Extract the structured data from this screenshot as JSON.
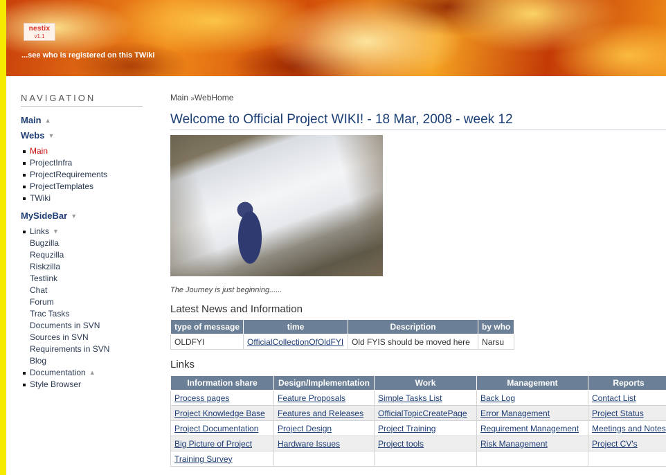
{
  "header": {
    "logo_text": "nestix",
    "logo_sub": "v1.1",
    "registered_link": "...see who is registered on this TWiki"
  },
  "sidebar": {
    "nav_title": "NAVIGATION",
    "main_label": "Main",
    "webs_label": "Webs",
    "webs": [
      "Main",
      "ProjectInfra",
      "ProjectRequirements",
      "ProjectTemplates",
      "TWiki"
    ],
    "mysidebar_label": "MySideBar",
    "links_label": "Links",
    "links": [
      "Bugzilla",
      "Requzilla",
      "Riskzilla",
      "Testlink",
      "Chat",
      "Forum",
      "Trac Tasks",
      "Documents in SVN",
      "Sources in SVN",
      "Requirements in SVN",
      "Blog"
    ],
    "documentation_label": "Documentation",
    "style_browser_label": "Style Browser"
  },
  "main": {
    "breadcrumb_main": "Main",
    "breadcrumb_sep": "»",
    "breadcrumb_page": "WebHome",
    "title": "Welcome to Official Project WIKI! - 18 Mar, 2008 - week 12",
    "caption": "The Journey is just beginning......",
    "news_heading": "Latest News and Information",
    "news_table": {
      "headers": [
        "type of message",
        "time",
        "Description",
        "by who"
      ],
      "rows": [
        [
          "OLDFYI",
          "OfficialCollectionOfOldFYI",
          "Old FYIS should be moved here",
          "Narsu"
        ]
      ]
    },
    "links_heading": "Links",
    "links_table": {
      "headers": [
        "Information share",
        "Design/Implementation",
        "Work",
        "Management",
        "Reports"
      ],
      "rows": [
        [
          "Process pages",
          "Feature Proposals",
          "Simple Tasks List",
          "Back Log",
          "Contact List"
        ],
        [
          "Project Knowledge Base",
          "Features and Releases",
          "OfficialTopicCreatePage",
          "Error Management",
          "Project Status"
        ],
        [
          "Project Documentation",
          "Project Design",
          "Project Training",
          "Requirement Management",
          "Meetings and Notes"
        ],
        [
          "Big Picture of Project",
          "Hardware Issues",
          "Project tools",
          "Risk Management",
          "Project CV's"
        ],
        [
          "Training Survey",
          "",
          "",
          "",
          ""
        ]
      ]
    }
  }
}
